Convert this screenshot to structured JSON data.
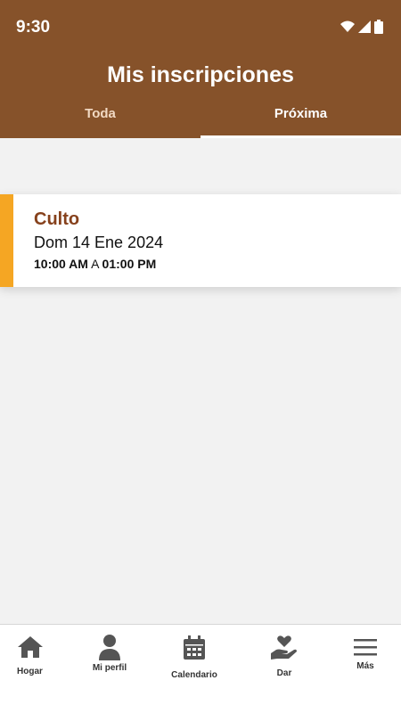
{
  "status_bar": {
    "time": "9:30",
    "icons": [
      "wifi-icon",
      "signal-icon",
      "battery-icon"
    ]
  },
  "header": {
    "title": "Mis inscripciones",
    "background_color": "#86522a"
  },
  "tabs": [
    {
      "label": "Toda",
      "active": false
    },
    {
      "label": "Próxima",
      "active": true
    }
  ],
  "registrations": [
    {
      "title": "Culto",
      "date": "Dom 14 Ene 2024",
      "start_time": "10:00 AM",
      "connector": "A",
      "end_time": "01:00 PM",
      "accent_color": "#f5a623"
    }
  ],
  "bottom_nav": [
    {
      "label": "Hogar",
      "icon": "home-icon"
    },
    {
      "label": "Mi perfil",
      "icon": "person-icon"
    },
    {
      "label": "Calendario",
      "icon": "calendar-icon"
    },
    {
      "label": "Dar",
      "icon": "hand-heart-icon"
    },
    {
      "label": "Más",
      "icon": "menu-icon"
    }
  ]
}
